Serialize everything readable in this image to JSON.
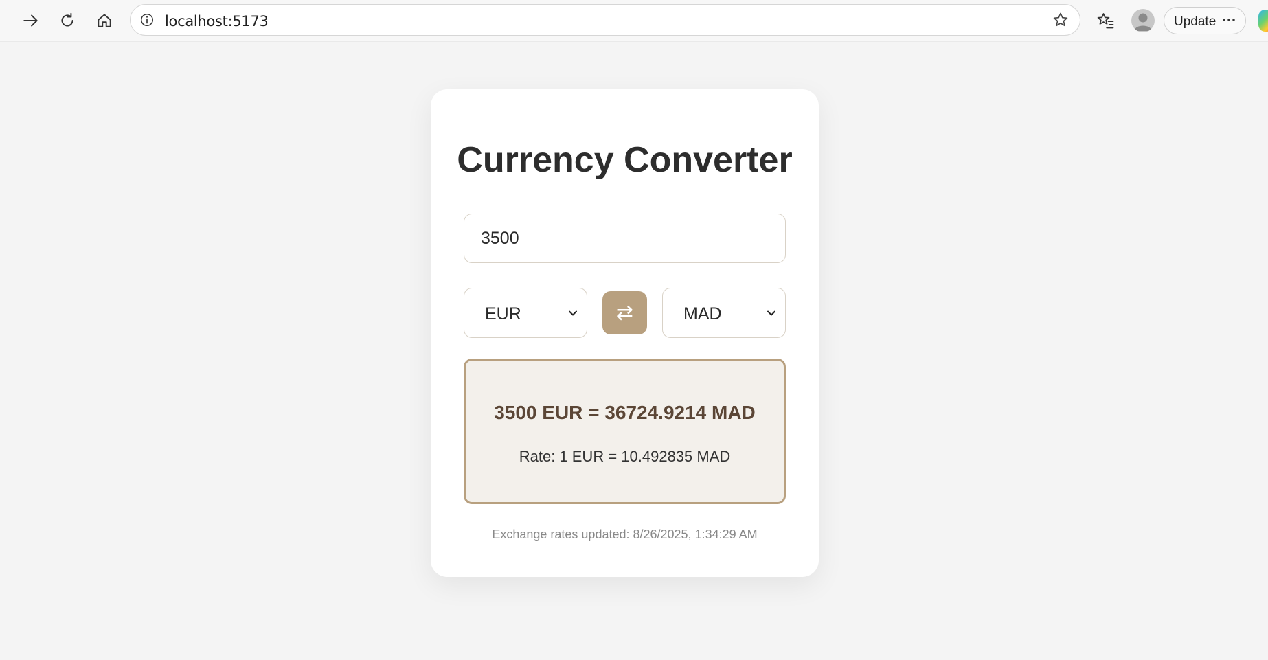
{
  "browser": {
    "url": "localhost:5173",
    "update_label": "Update",
    "icons": {
      "forward": "arrow-right-icon",
      "reload": "reload-icon",
      "home": "home-icon",
      "info": "info-icon",
      "favorite": "star-icon",
      "favorites": "favorites-list-icon",
      "profile": "profile-avatar-icon",
      "more": "more-dots-icon",
      "copilot": "copilot-icon"
    }
  },
  "converter": {
    "title": "Currency Converter",
    "amount": "3500",
    "from_currency": "EUR",
    "to_currency": "MAD",
    "swap_symbol": "⇄",
    "result": "3500 EUR = 36724.9214 MAD",
    "rate": "Rate: 1 EUR = 10.492835 MAD",
    "updated": "Exchange rates updated: 8/26/2025, 1:34:29 AM"
  },
  "colors": {
    "accent": "#b8a07f",
    "result_bg": "#f3f0eb",
    "result_text": "#5b4636",
    "page_bg": "#f4f4f4"
  }
}
